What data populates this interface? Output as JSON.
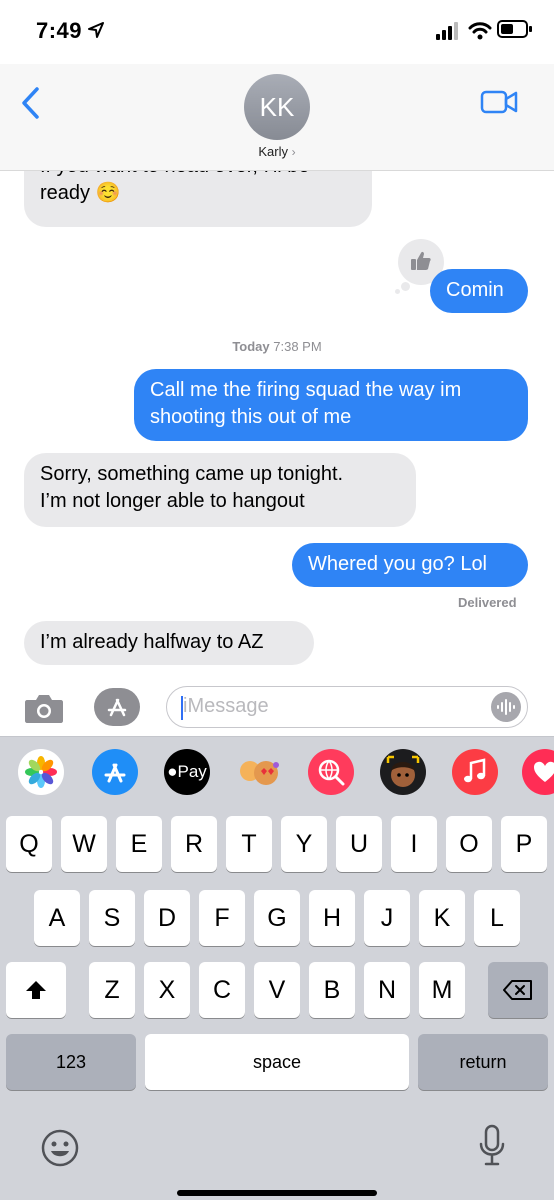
{
  "status_bar": {
    "time": "7:49"
  },
  "header": {
    "avatar_initials": "KK",
    "contact_name": "Karly",
    "chevron": "›"
  },
  "messages": [
    {
      "side": "in",
      "line1": "If you want to head over, I'll be",
      "line2": "ready ☺️"
    },
    {
      "side": "out",
      "text": "Comin",
      "tapback": "thumbs-up-icon"
    },
    {
      "timestamp_day": "Today",
      "timestamp_time": "7:38 PM"
    },
    {
      "side": "out",
      "line1": "Call me the firing squad the way im",
      "line2": "shooting this out of me"
    },
    {
      "side": "in",
      "line1": "Sorry, something came up tonight.",
      "line2": "I’m not longer able to hangout"
    },
    {
      "side": "out",
      "text": "Whered you go? Lol",
      "status": "Delivered"
    },
    {
      "side": "in",
      "text": "I’m already halfway to AZ"
    }
  ],
  "composer": {
    "placeholder": "iMessage"
  },
  "app_strip": {
    "icons": [
      "photos-icon",
      "app-store-icon",
      "apple-pay-icon",
      "memoji-stickers-icon",
      "web-images-icon",
      "memoji-icon",
      "music-icon",
      "digital-touch-icon"
    ],
    "apple_pay_label": "Pay"
  },
  "keyboard": {
    "row1": [
      "Q",
      "W",
      "E",
      "R",
      "T",
      "Y",
      "U",
      "I",
      "O",
      "P"
    ],
    "row2": [
      "A",
      "S",
      "D",
      "F",
      "G",
      "H",
      "J",
      "K",
      "L"
    ],
    "row3": [
      "Z",
      "X",
      "C",
      "V",
      "B",
      "N",
      "M"
    ],
    "numbers_label": "123",
    "space_label": "space",
    "return_label": "return"
  },
  "colors": {
    "outgoing_bubble": "#2f84f5",
    "incoming_bubble": "#e9e9eb",
    "keyboard_bg": "#d1d3d9"
  }
}
